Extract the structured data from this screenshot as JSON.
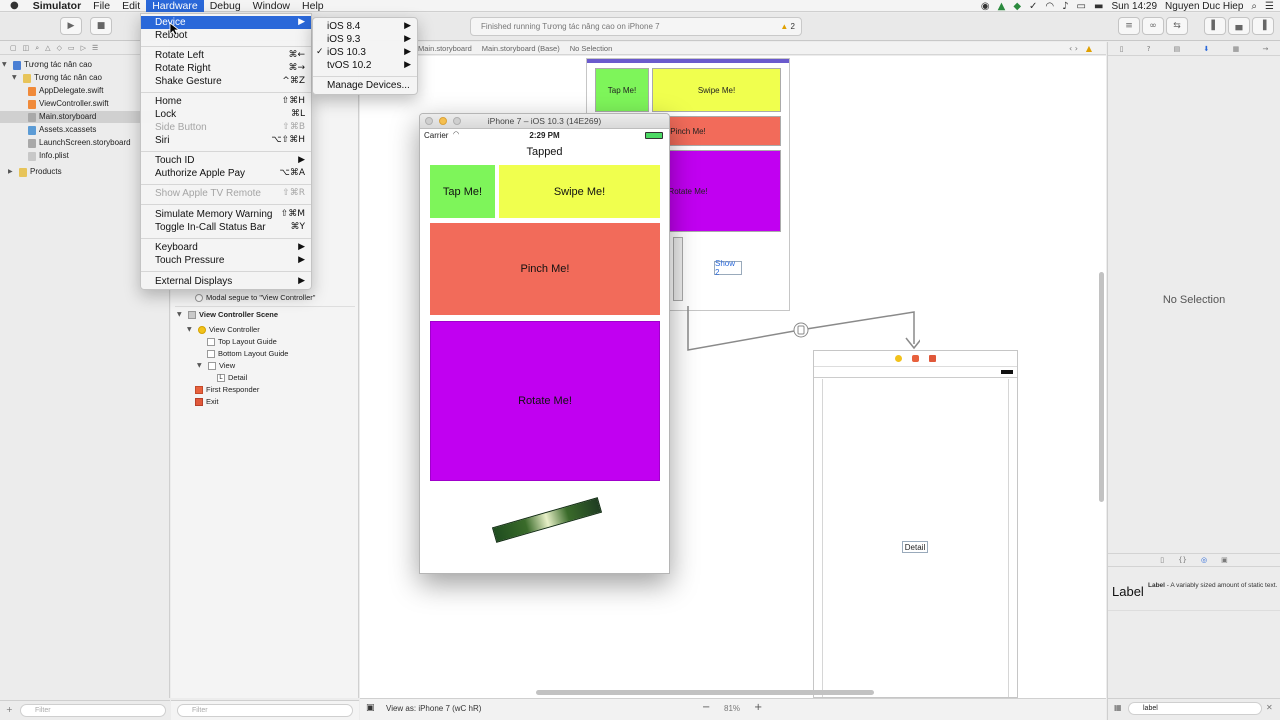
{
  "menubar": {
    "app_name": "Simulator",
    "items": [
      "File",
      "Edit",
      "Hardware",
      "Debug",
      "Window",
      "Help"
    ],
    "clock": "Sun 14:29",
    "user": "Nguyen Duc Hiep"
  },
  "toolbar": {
    "status": "Finished running Tương tác nâng cao on iPhone 7",
    "warning_count": "2"
  },
  "jumpbar": {
    "items": [
      "Main.storyboard",
      "Main.storyboard (Base)",
      "No Selection"
    ]
  },
  "navigator": {
    "items": [
      {
        "label": "Tương tác nân cao"
      },
      {
        "label": "Tương tác nân cao"
      },
      {
        "label": "AppDelegate.swift"
      },
      {
        "label": "ViewController.swift"
      },
      {
        "label": "Main.storyboard"
      },
      {
        "label": "Assets.xcassets"
      },
      {
        "label": "LaunchScreen.storyboard"
      },
      {
        "label": "Info.plist"
      },
      {
        "label": "Products"
      }
    ],
    "filter_placeholder": "Filter"
  },
  "outline": {
    "items": [
      {
        "label": "Modal segue to \"View Controller\""
      },
      {
        "label": "View Controller Scene"
      },
      {
        "label": "View Controller"
      },
      {
        "label": "Top Layout Guide"
      },
      {
        "label": "Bottom Layout Guide"
      },
      {
        "label": "View"
      },
      {
        "label": "Detail"
      },
      {
        "label": "First Responder"
      },
      {
        "label": "Exit"
      }
    ],
    "filter_placeholder": "Filter"
  },
  "canvas": {
    "sb_tap": "Tap Me!",
    "sb_swipe": "Swipe Me!",
    "sb_pinch": "Pinch Me!",
    "sb_rotate": "Rotate Me!",
    "sb_show2": "Show 2",
    "detail": "Detail",
    "view_as": "View as: iPhone 7 (wC hR)",
    "zoom": "81%"
  },
  "inspector": {
    "no_selection": "No Selection",
    "library_title": "Label",
    "library_name": "Label",
    "library_desc": " - A variably sized amount of static text.",
    "search_value": "label"
  },
  "simulator": {
    "title": "iPhone 7 – iOS 10.3 (14E269)",
    "carrier": "Carrier",
    "time": "2:29 PM",
    "tapped": "Tapped",
    "tap": "Tap Me!",
    "swipe": "Swipe Me!",
    "pinch": "Pinch Me!",
    "rotate": "Rotate Me!",
    "colors": {
      "tap": "#7ef55a",
      "swipe": "#f0ff4e",
      "pinch": "#f26b5a",
      "rotate": "#c100f1"
    }
  },
  "hardware_menu": {
    "device": "Device",
    "reboot": "Reboot",
    "rotate_left": "Rotate Left",
    "rotate_left_sc": "⌘←",
    "rotate_right": "Rotate Right",
    "rotate_right_sc": "⌘→",
    "shake": "Shake Gesture",
    "shake_sc": "^⌘Z",
    "home": "Home",
    "home_sc": "⇧⌘H",
    "lock": "Lock",
    "lock_sc": "⌘L",
    "side_button": "Side Button",
    "side_button_sc": "⇧⌘B",
    "siri": "Siri",
    "siri_sc": "⌥⇧⌘H",
    "touch_id": "Touch ID",
    "apple_pay": "Authorize Apple Pay",
    "apple_pay_sc": "⌥⌘A",
    "tv_remote": "Show Apple TV Remote",
    "tv_remote_sc": "⇧⌘R",
    "memory": "Simulate Memory Warning",
    "memory_sc": "⇧⌘M",
    "status_bar": "Toggle In-Call Status Bar",
    "status_bar_sc": "⌘Y",
    "keyboard": "Keyboard",
    "touch_pressure": "Touch Pressure",
    "external": "External Displays"
  },
  "device_menu": {
    "items": [
      "iOS 8.4",
      "iOS 9.3",
      "iOS 10.3",
      "tvOS 10.2"
    ],
    "manage": "Manage Devices..."
  }
}
